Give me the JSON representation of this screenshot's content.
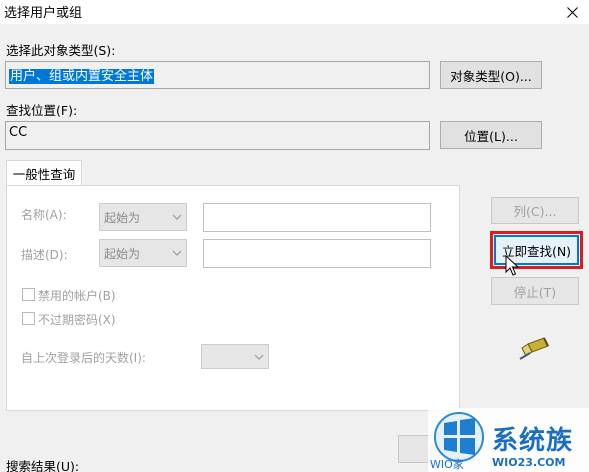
{
  "window": {
    "title": "选择用户或组"
  },
  "object_type": {
    "label": "选择此对象类型(S):",
    "value": "用户、组或内置安全主体",
    "button": "对象类型(O)..."
  },
  "location": {
    "label": "查找位置(F):",
    "value": "CC",
    "button": "位置(L)..."
  },
  "tab": {
    "label": "一般性查询"
  },
  "query": {
    "name_label": "名称(A):",
    "name_combo": "起始为",
    "desc_label": "描述(D):",
    "desc_combo": "起始为",
    "disabled_accounts": "禁用的帐户(B)",
    "no_expire_password": "不过期密码(X)",
    "days_since_login": "自上次登录后的天数(I):"
  },
  "side_buttons": {
    "columns": "列(C)...",
    "find_now": "立即查找(N)",
    "stop": "停止(T)"
  },
  "bottom": {
    "results_label": "搜索结果(U):",
    "ok_button_partial": "确"
  },
  "watermark": {
    "brand": "系统族",
    "site_left": "WIO家",
    "site_right": "WIO23.COM"
  },
  "colors": {
    "selection": "#0078d7",
    "highlight": "#d81e1e",
    "focus": "#0078d7"
  }
}
